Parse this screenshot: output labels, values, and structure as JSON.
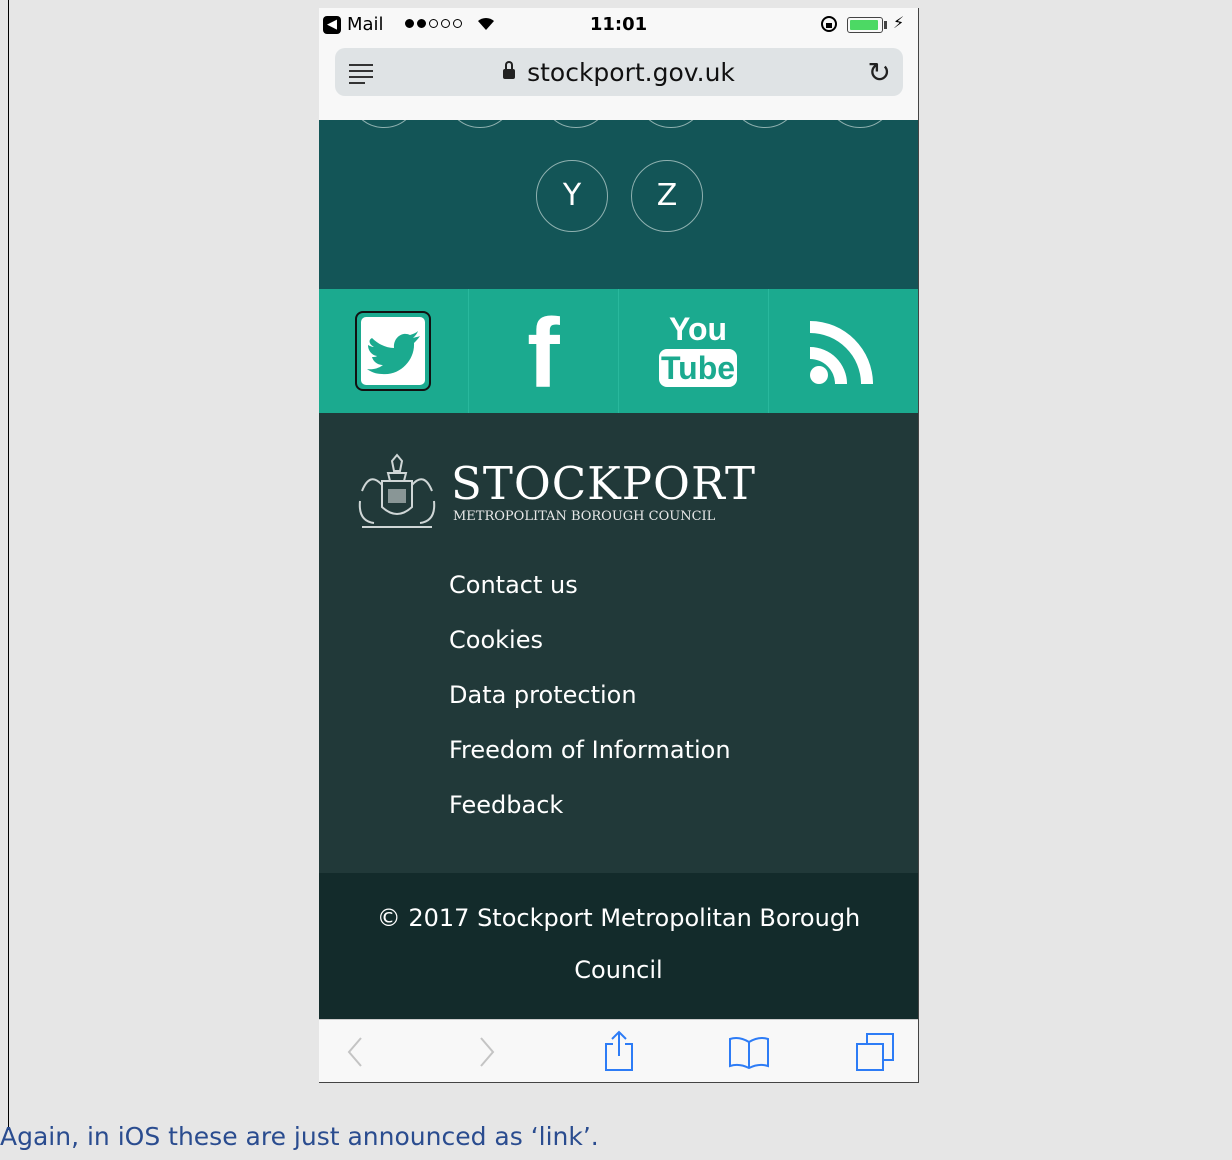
{
  "status_bar": {
    "back_app": "Mail",
    "time": "11:01",
    "back_chip": "◀"
  },
  "browser": {
    "url": "stockport.gov.uk"
  },
  "az_index": {
    "visible_letters": [
      "Y",
      "Z"
    ]
  },
  "social": {
    "items": [
      "twitter",
      "facebook",
      "youtube",
      "rss"
    ],
    "youtube_top": "You",
    "youtube_bottom": "Tube",
    "facebook_glyph": "f"
  },
  "council": {
    "name": "STOCKPORT",
    "subtitle": "METROPOLITAN BOROUGH COUNCIL"
  },
  "footer_links": [
    "Contact us",
    "Cookies",
    "Data protection",
    "Freedom of Information",
    "Feedback"
  ],
  "copyright": {
    "line1": "© 2017 Stockport Metropolitan Borough",
    "line2": "Council"
  },
  "caption": "Again, in iOS these are just announced as ‘link’.",
  "colors": {
    "az_bg": "#135557",
    "social_bg": "#1baa8f",
    "footer_bg": "#213939",
    "copyright_bg": "#132b2b",
    "caption": "#2a4c8f"
  }
}
